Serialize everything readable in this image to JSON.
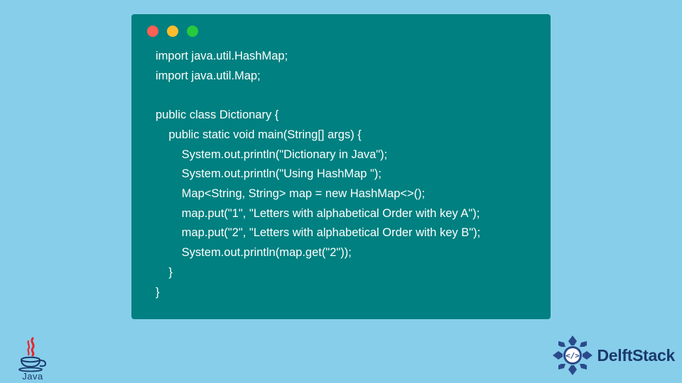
{
  "code": {
    "lines": [
      "import java.util.HashMap;",
      "import java.util.Map;",
      "",
      "public class Dictionary {",
      "    public static void main(String[] args) {",
      "        System.out.println(\"Dictionary in Java\");",
      "        System.out.println(\"Using HashMap \");",
      "        Map<String, String> map = new HashMap<>();",
      "        map.put(\"1\", \"Letters with alphabetical Order with key A\");",
      "        map.put(\"2\", \"Letters with alphabetical Order with key B\");",
      "        System.out.println(map.get(\"2\"));",
      "    }",
      "}"
    ]
  },
  "branding": {
    "java_label": "Java",
    "site_name": "DelftStack"
  },
  "colors": {
    "page_bg": "#87ceeb",
    "window_bg": "#008080",
    "code_text": "#ffffff",
    "brand_text": "#1a3a6e"
  }
}
